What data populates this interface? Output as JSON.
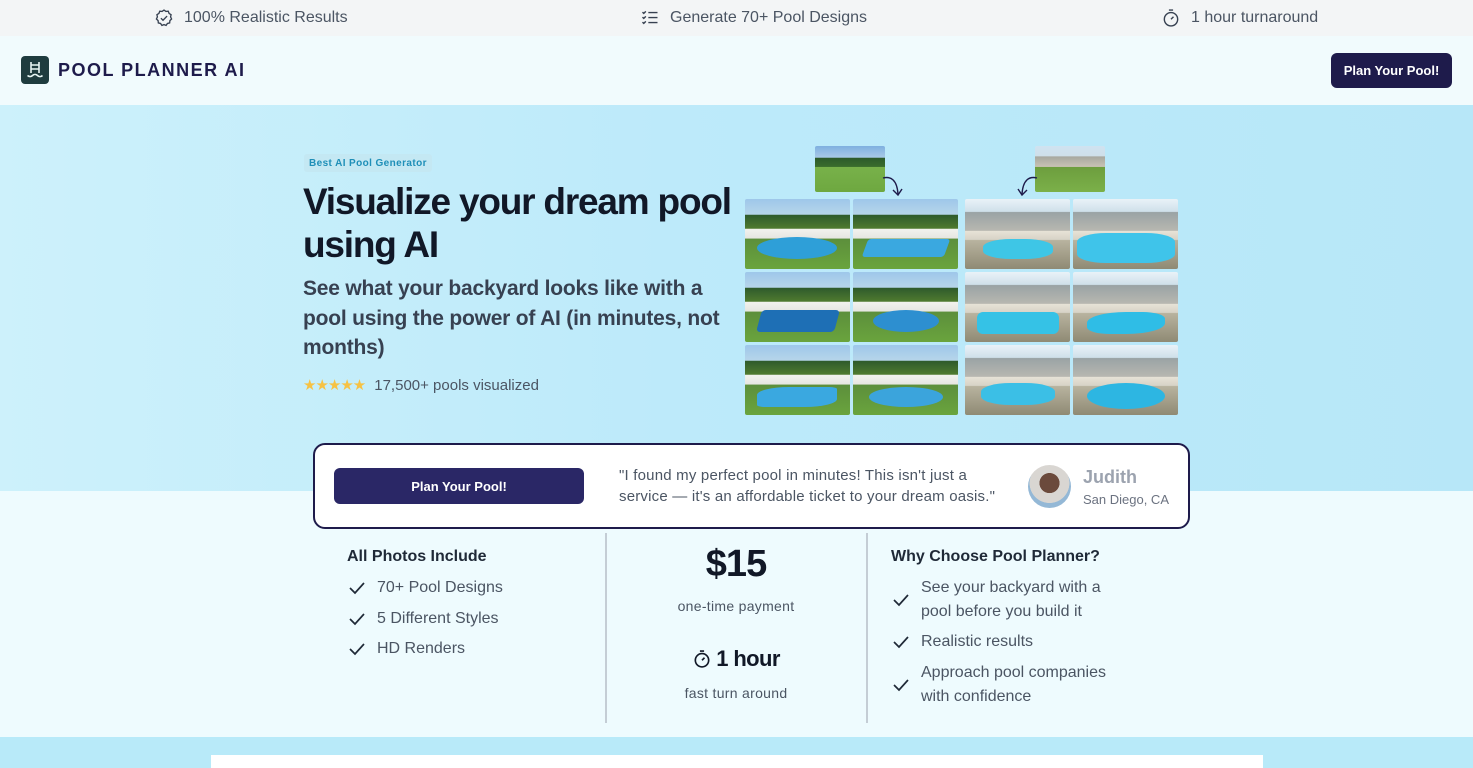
{
  "topbar": {
    "features": [
      {
        "icon": "badge-check-icon",
        "label": "100% Realistic Results"
      },
      {
        "icon": "checklist-icon",
        "label": "Generate 70+ Pool Designs"
      },
      {
        "icon": "stopwatch-icon",
        "label": "1 hour turnaround"
      }
    ]
  },
  "header": {
    "logo_text": "POOL PLANNER AI",
    "cta_label": "Plan Your Pool!"
  },
  "hero": {
    "badge": "Best AI Pool Generator",
    "title": "Visualize your dream pool using AI",
    "subtitle": "See what your backyard looks like with a pool using the power of AI (in minutes, not months)",
    "stars": "★★★★★",
    "rating_text": "17,500+ pools visualized"
  },
  "testimonial": {
    "cta_label": "Plan Your Pool!",
    "quote": "\"I found my perfect pool in minutes! This isn't just a service — it's an affordable ticket to your dream oasis.\"",
    "name": "Judith",
    "location": "San Diego, CA"
  },
  "includes": {
    "title": "All Photos Include",
    "items": [
      "70+ Pool Designs",
      "5 Different Styles",
      "HD Renders"
    ]
  },
  "pricing": {
    "price": "$15",
    "price_note": "one-time payment",
    "turnaround": "1 hour",
    "turnaround_note": "fast turn around"
  },
  "why": {
    "title": "Why Choose Pool Planner?",
    "items": [
      "See your backyard with a pool before you build it",
      "Realistic results",
      "Approach pool companies with confidence"
    ]
  },
  "colors": {
    "brand_navy": "#1e1b4b",
    "star": "#f6c244",
    "pool_blue": "#3aa8e0"
  }
}
